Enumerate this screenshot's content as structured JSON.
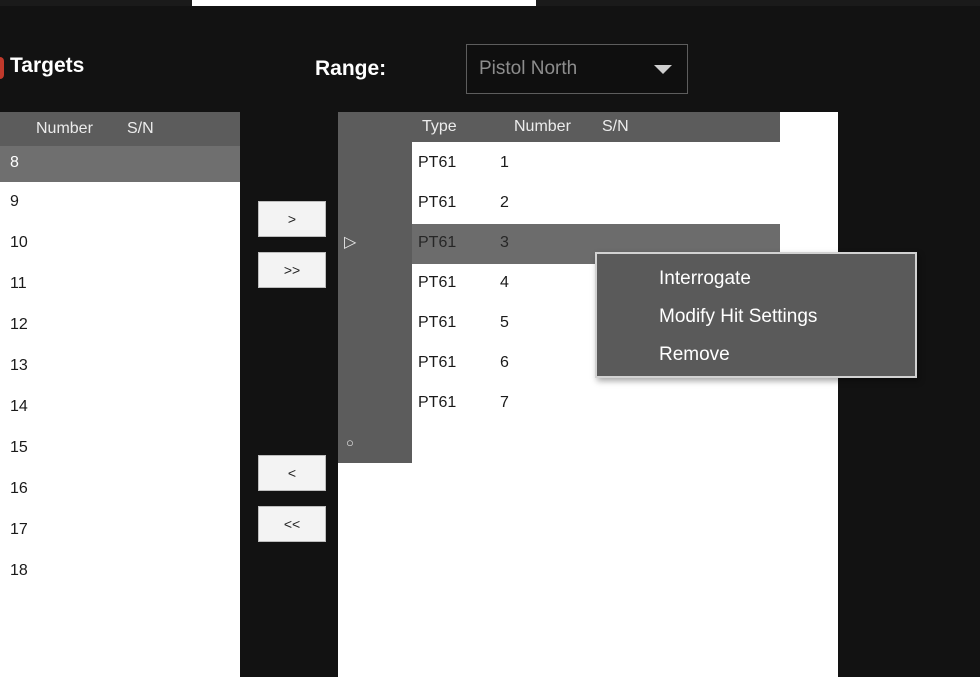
{
  "header": {
    "title": "Targets",
    "range_label": "Range:",
    "range_value": "Pistol North"
  },
  "available_targets": {
    "columns": [
      "Number",
      "S/N"
    ],
    "rows": [
      "8",
      "9",
      "10",
      "11",
      "12",
      "13",
      "14",
      "15",
      "16",
      "17",
      "18"
    ],
    "selected_row": "8"
  },
  "transfer_buttons": {
    "add_one": ">",
    "add_all": ">>",
    "remove_one": "<",
    "remove_all": "<<"
  },
  "assigned_targets": {
    "columns": [
      "Type",
      "Number",
      "S/N"
    ],
    "rows": [
      {
        "type": "PT61",
        "number": "1"
      },
      {
        "type": "PT61",
        "number": "2"
      },
      {
        "type": "PT61",
        "number": "3"
      },
      {
        "type": "PT61",
        "number": "4"
      },
      {
        "type": "PT61",
        "number": "5"
      },
      {
        "type": "PT61",
        "number": "6"
      },
      {
        "type": "PT61",
        "number": "7"
      }
    ],
    "current_row": "3",
    "current_row_marker": "▷",
    "new_row_marker": "○"
  },
  "context_menu": {
    "items": [
      "Interrogate",
      "Modify Hit Settings",
      "Remove"
    ]
  },
  "colors": {
    "background": "#121212",
    "header_gray": "#5c5c5c",
    "selected_gray": "#6f6f6f",
    "menu_bg": "#5a5a5a",
    "accent_red": "#c0392b"
  }
}
